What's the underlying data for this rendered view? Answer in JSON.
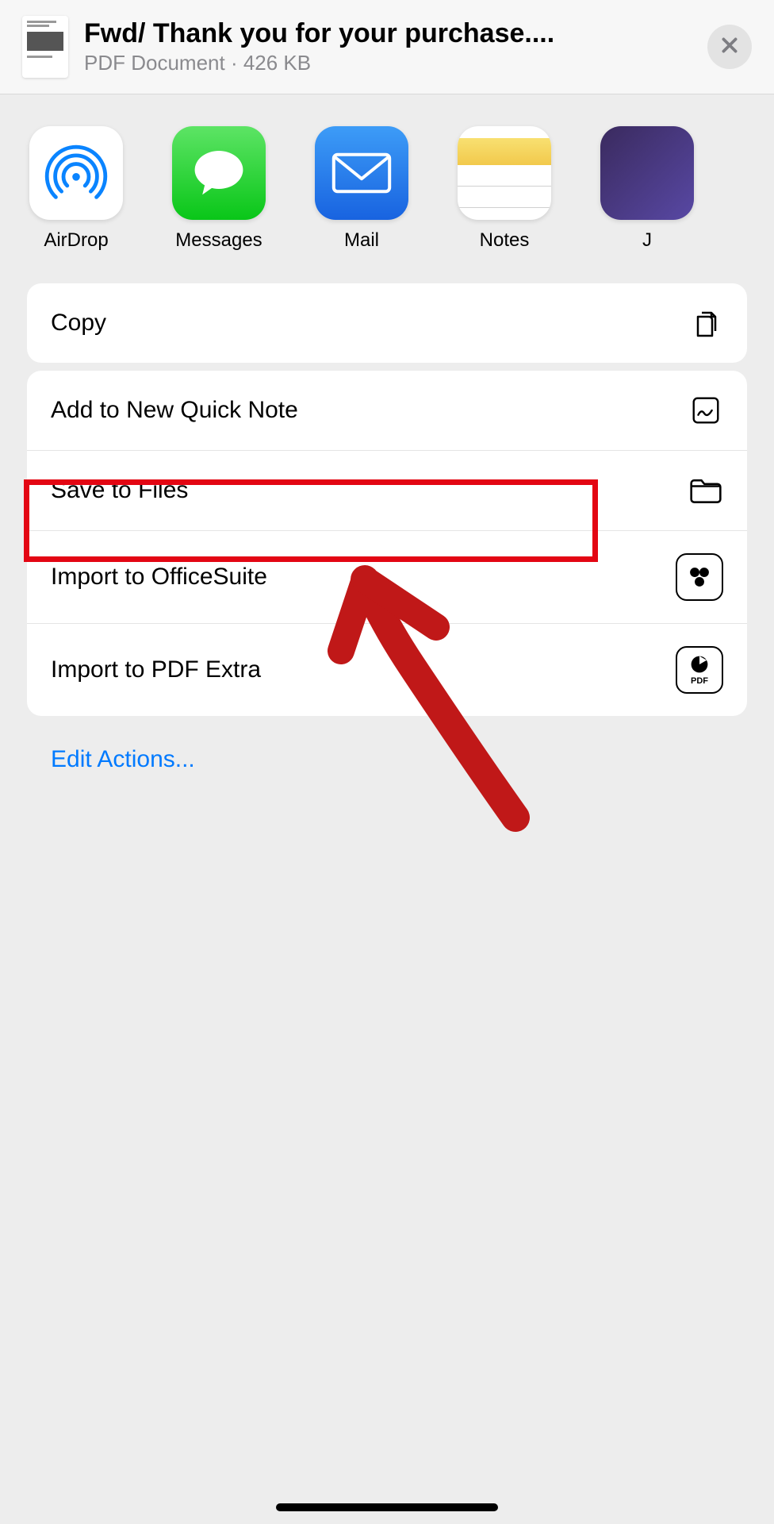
{
  "header": {
    "title": "Fwd/ Thank you for your purchase....",
    "subtitle": "PDF Document · 426 KB"
  },
  "apps": [
    {
      "name": "airdrop",
      "label": "AirDrop"
    },
    {
      "name": "messages",
      "label": "Messages"
    },
    {
      "name": "mail",
      "label": "Mail"
    },
    {
      "name": "notes",
      "label": "Notes"
    },
    {
      "name": "journal",
      "label": "J"
    }
  ],
  "group1": {
    "copy": "Copy"
  },
  "group2": {
    "quicknote": "Add to New Quick Note",
    "savetofiles": "Save to Files",
    "officesuite": "Import to OfficeSuite",
    "pdfextra": "Import to PDF Extra",
    "pdfextra_badge": "PDF"
  },
  "edit_actions": "Edit Actions...",
  "annotation": {
    "highlight_target": "save-to-files"
  }
}
